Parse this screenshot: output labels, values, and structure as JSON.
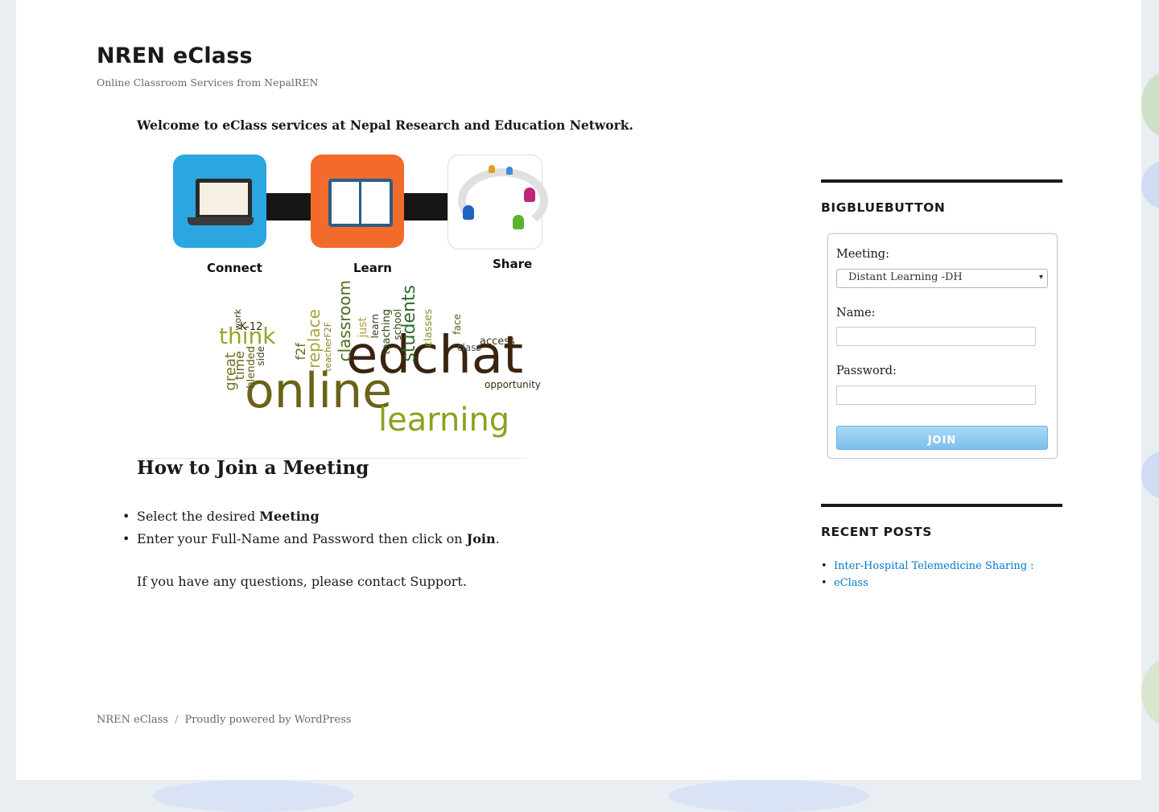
{
  "header": {
    "site_title": "NREN eClass",
    "site_description": "Online Classroom Services from NepalREN"
  },
  "main": {
    "welcome": "Welcome to eClass services at Nepal Research and Education Network.",
    "graphic_labels": [
      "Connect",
      "Learn",
      "Share"
    ],
    "word_cloud": [
      "edchat",
      "online",
      "learning",
      "think",
      "students",
      "classroom",
      "replace",
      "teacherF2F",
      "access",
      "class",
      "great",
      "time",
      "blended",
      "opportunity",
      "K-12",
      "work",
      "teaching",
      "school",
      "classes",
      "face",
      "just",
      "learn",
      "f2f",
      "side"
    ],
    "howto_heading": "How to Join a Meeting",
    "steps": [
      {
        "before": "Select the desired ",
        "bold": "Meeting",
        "after": ""
      },
      {
        "before": "Enter your Full-Name and Password then click on ",
        "bold": "Join",
        "after": "."
      }
    ],
    "questions": "If you have any questions, please contact Support."
  },
  "sidebar": {
    "bbb_title": "BigBlueButton",
    "meeting_label": "Meeting:",
    "meeting_selected": "Distant Learning -DH",
    "name_label": "Name:",
    "name_value": "",
    "password_label": "Password:",
    "password_value": "",
    "join_label": "JOIN",
    "recent_title": "Recent Posts",
    "recent_posts": [
      "Inter-Hospital Telemedicine Sharing :",
      "eClass"
    ]
  },
  "footer": {
    "site_link": "NREN eClass",
    "separator": "/",
    "powered_by": "Proudly powered by WordPress"
  },
  "colors": {
    "link": "#007acc",
    "join_button": "#7cc0ed",
    "connect_tile": "#2ca6e0",
    "learn_tile": "#f36b2b"
  }
}
